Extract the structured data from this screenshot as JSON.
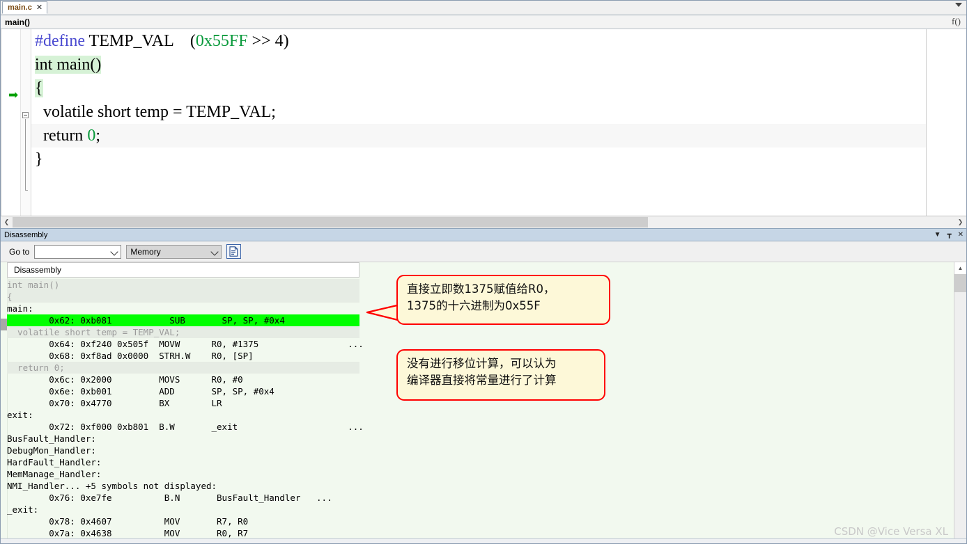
{
  "editor": {
    "tab": {
      "label": "main.c",
      "close": "✕"
    },
    "breadcrumb": {
      "path": "main()",
      "fn_icon": "f()"
    },
    "code_lines": [
      {
        "text": "#define TEMP_VAL    (0x55FF >> 4)"
      },
      {
        "text": "int main()"
      },
      {
        "text": "{"
      },
      {
        "text": "  volatile short temp = TEMP_VAL;"
      },
      {
        "text": "  return 0;"
      },
      {
        "text": "}"
      }
    ],
    "tokens": {
      "define": "#define",
      "temp_val": " TEMP_VAL",
      "macro_expr_open": "    (",
      "macro_hex": "0x55FF",
      "macro_shift": " >> 4",
      "macro_close": ")",
      "int_kw": "int main()",
      "brace_open": "{",
      "decl": "  volatile short temp = TEMP_VAL;",
      "return_kw": "  return ",
      "return_val": "0",
      "return_semi": ";",
      "brace_close": "}"
    },
    "exec_arrow": "➡"
  },
  "panel": {
    "title": "Disassembly",
    "buttons": {
      "menu": "▼",
      "pin": "┳",
      "close": "✕"
    },
    "toolbar": {
      "goto_label": "Go to",
      "goto_value": "",
      "goto_placeholder": "",
      "memory_value": "Memory",
      "memory_options": [
        "Memory"
      ],
      "doc_icon": "document-icon"
    },
    "list_header": "Disassembly",
    "lines": [
      {
        "kind": "src",
        "text": "int main()"
      },
      {
        "kind": "src",
        "text": "{"
      },
      {
        "kind": "lbl",
        "text": "main:"
      },
      {
        "kind": "cur",
        "text": "        0x62: 0xb081           SUB       SP, SP, #0x4"
      },
      {
        "kind": "src",
        "text": "  volatile short temp = TEMP_VAL;"
      },
      {
        "kind": "code",
        "text": "        0x64: 0xf240 0x505f  MOVW      R0, #1375                 ..."
      },
      {
        "kind": "code",
        "text": "        0x68: 0xf8ad 0x0000  STRH.W    R0, [SP]"
      },
      {
        "kind": "src",
        "text": "  return 0;"
      },
      {
        "kind": "code",
        "text": "        0x6c: 0x2000         MOVS      R0, #0"
      },
      {
        "kind": "code",
        "text": "        0x6e: 0xb001         ADD       SP, SP, #0x4"
      },
      {
        "kind": "code",
        "text": "        0x70: 0x4770         BX        LR"
      },
      {
        "kind": "lbl",
        "text": "exit:"
      },
      {
        "kind": "code",
        "text": "        0x72: 0xf000 0xb801  B.W       _exit                     ..."
      },
      {
        "kind": "lbl",
        "text": "BusFault_Handler:"
      },
      {
        "kind": "lbl",
        "text": "DebugMon_Handler:"
      },
      {
        "kind": "lbl",
        "text": "HardFault_Handler:"
      },
      {
        "kind": "lbl",
        "text": "MemManage_Handler:"
      },
      {
        "kind": "lbl",
        "text": "NMI_Handler... +5 symbols not displayed:"
      },
      {
        "kind": "code",
        "text": "        0x76: 0xe7fe          B.N       BusFault_Handler   ..."
      },
      {
        "kind": "lbl",
        "text": "_exit:"
      },
      {
        "kind": "code",
        "text": "        0x78: 0x4607          MOV       R7, R0"
      },
      {
        "kind": "code",
        "text": "        0x7a: 0x4638          MOV       R0, R7"
      }
    ]
  },
  "annotations": [
    {
      "id": "callout-movw",
      "line1": "直接立即数1375赋值给R0，",
      "line2": "1375的十六进制为0x55F"
    },
    {
      "id": "callout-no-shift",
      "line1": "没有进行移位计算，可以认为",
      "line2": "编译器直接将常量进行了计算"
    }
  ],
  "watermark": "CSDN @Vice Versa XL",
  "colors": {
    "highlight_current_line": "#00ff00",
    "callout_border": "#ff0000",
    "callout_fill": "#fdf8d8",
    "panel_title_bg": "#c6d6e6",
    "disasm_bg": "#f2f9ef",
    "editor_hl": "#d6f2d6",
    "tab_label": "#7a4a12"
  },
  "scrollbars": {
    "editor_h_left": "❮",
    "editor_h_right": "❯",
    "panel_v_up": "▲",
    "panel_v_down": "▼"
  }
}
